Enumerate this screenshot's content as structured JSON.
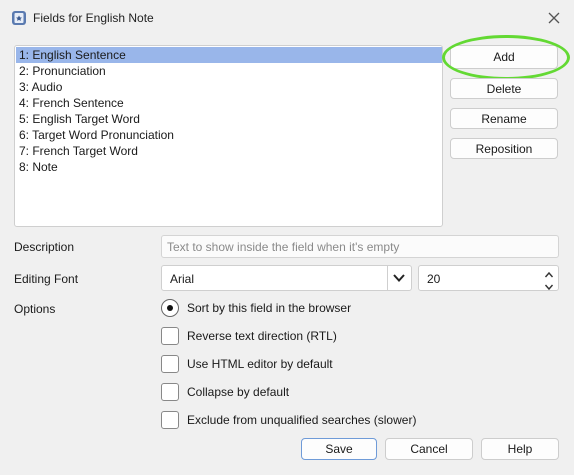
{
  "window": {
    "title": "Fields for English Note",
    "app_icon": "anki-icon",
    "close_icon": "close-icon"
  },
  "fields": {
    "items": [
      {
        "label": "1: English Sentence",
        "selected": true
      },
      {
        "label": "2: Pronunciation",
        "selected": false
      },
      {
        "label": "3: Audio",
        "selected": false
      },
      {
        "label": "4: French Sentence",
        "selected": false
      },
      {
        "label": "5: English Target Word",
        "selected": false
      },
      {
        "label": "6: Target Word Pronunciation",
        "selected": false
      },
      {
        "label": "7: French Target Word",
        "selected": false
      },
      {
        "label": "8: Note",
        "selected": false
      }
    ]
  },
  "side_buttons": {
    "add": "Add",
    "delete": "Delete",
    "rename": "Rename",
    "reposition": "Reposition"
  },
  "form": {
    "description_label": "Description",
    "description_placeholder": "Text to show inside the field when it's empty",
    "description_value": "",
    "editing_font_label": "Editing Font",
    "font_value": "Arial",
    "font_size": "20",
    "options_label": "Options"
  },
  "options": [
    {
      "label": "Sort by this field in the browser",
      "kind": "radio",
      "checked": true
    },
    {
      "label": "Reverse text direction (RTL)",
      "kind": "checkbox",
      "checked": false
    },
    {
      "label": "Use HTML editor by default",
      "kind": "checkbox",
      "checked": false
    },
    {
      "label": "Collapse by default",
      "kind": "checkbox",
      "checked": false
    },
    {
      "label": "Exclude from unqualified searches (slower)",
      "kind": "checkbox",
      "checked": false
    }
  ],
  "footer": {
    "save": "Save",
    "cancel": "Cancel",
    "help": "Help"
  },
  "colors": {
    "selection": "#99b6ea",
    "highlight_ring": "#63d933",
    "default_button_border": "#6f9bd8"
  }
}
